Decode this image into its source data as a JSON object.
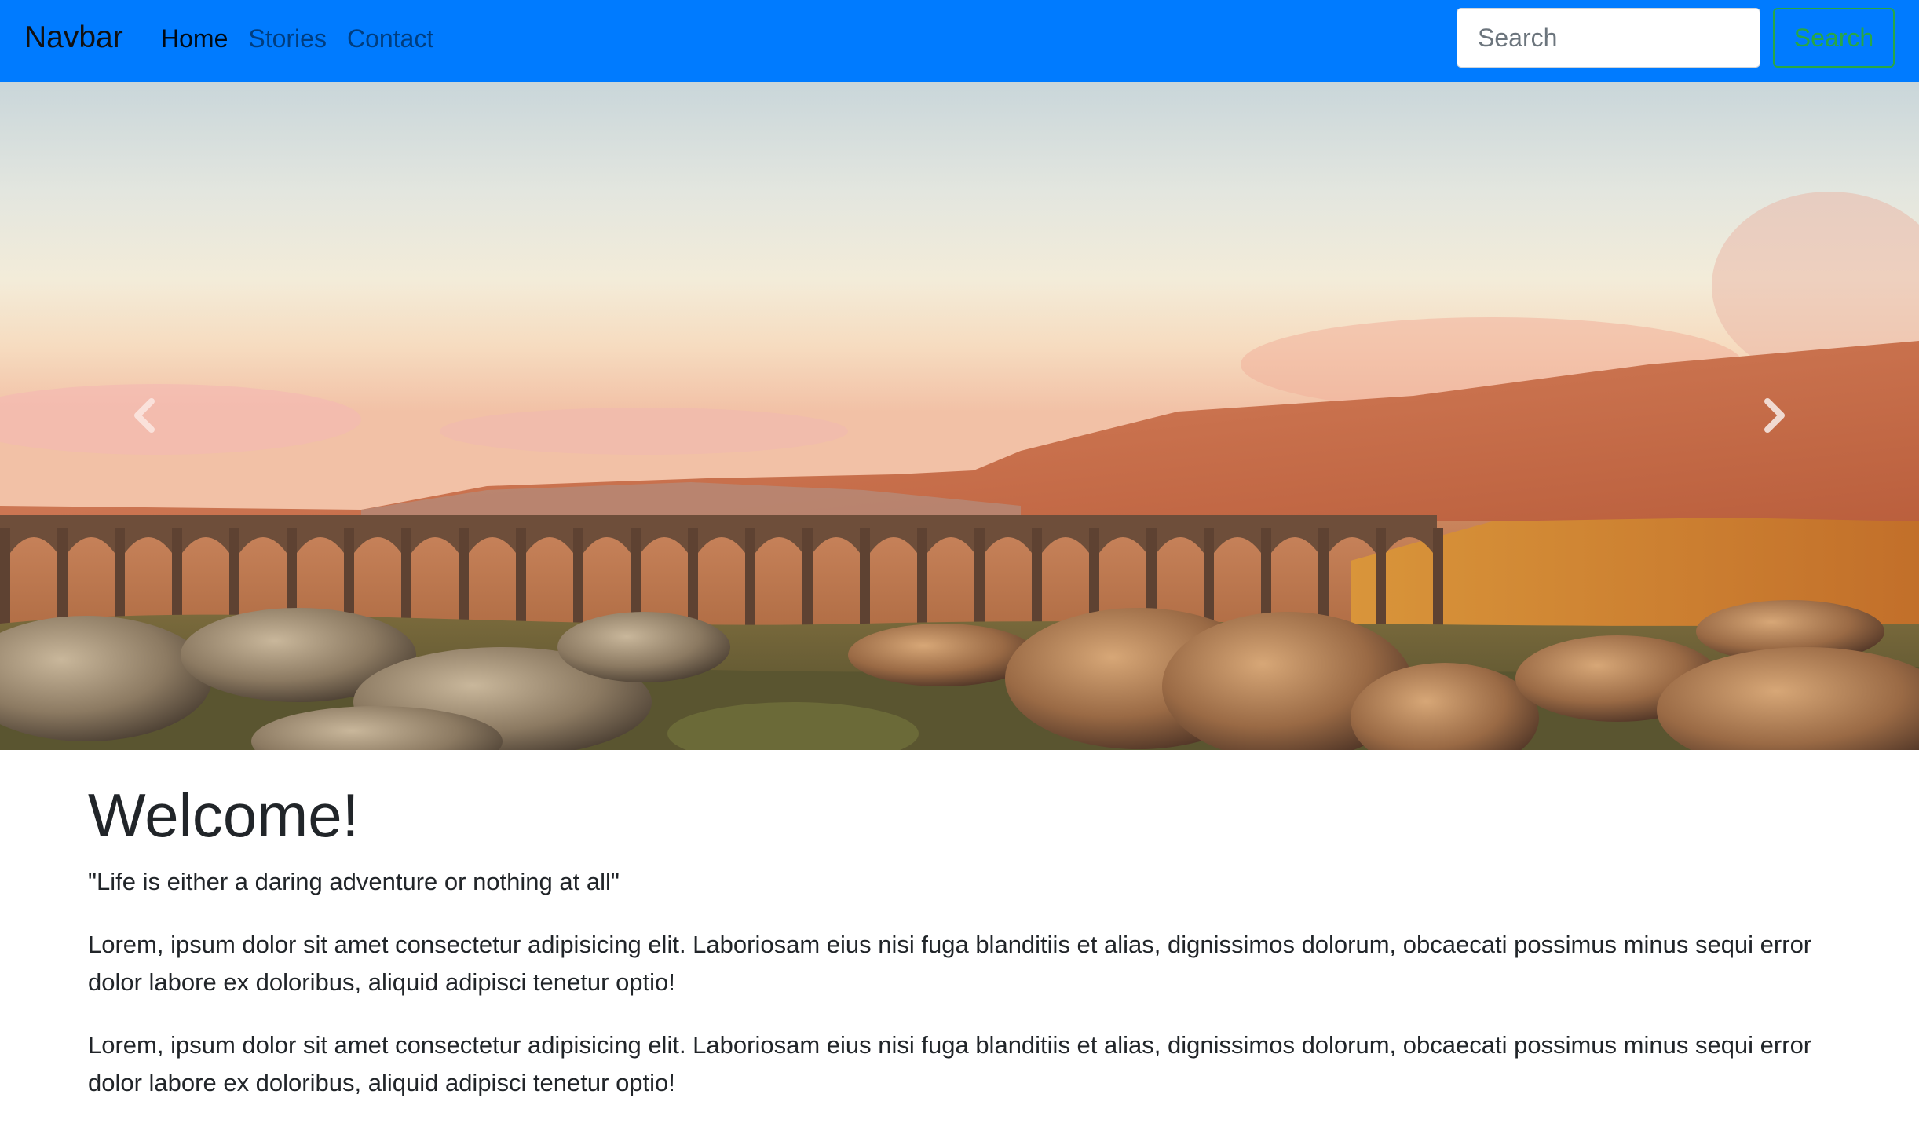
{
  "navbar": {
    "brand": "Navbar",
    "links": [
      {
        "label": "Home",
        "active": true
      },
      {
        "label": "Stories",
        "active": false
      },
      {
        "label": "Contact",
        "active": false
      }
    ],
    "search": {
      "placeholder": "Search",
      "button_label": "Search"
    },
    "colors": {
      "background": "#007bff",
      "search_button": "#28a745"
    }
  },
  "carousel": {
    "prev_icon": "chevron-left-icon",
    "next_icon": "chevron-right-icon"
  },
  "main": {
    "title": "Welcome!",
    "quote": "\"Life is either a daring adventure or nothing at all\"",
    "paragraphs": [
      "Lorem, ipsum dolor sit amet consectetur adipisicing elit. Laboriosam eius nisi fuga blanditiis et alias, dignissimos dolorum, obcaecati possimus minus sequi error dolor labore ex doloribus, aliquid adipisci tenetur optio!",
      "Lorem, ipsum dolor sit amet consectetur adipisicing elit. Laboriosam eius nisi fuga blanditiis et alias, dignissimos dolorum, obcaecati possimus minus sequi error dolor labore ex doloribus, aliquid adipisci tenetur optio!"
    ]
  }
}
